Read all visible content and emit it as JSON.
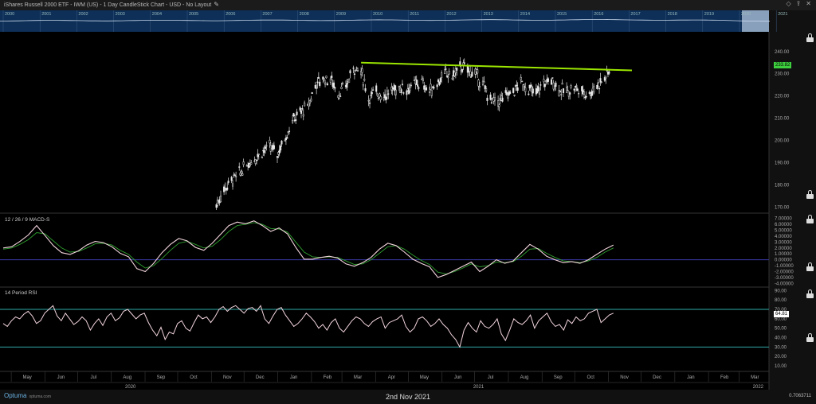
{
  "header": {
    "title": "iShares Russell 2000 ETF - IWM (US) - 1 Day CandleStick Chart - USD - No Layout",
    "icons": [
      "diamond-icon",
      "share-icon",
      "close-icon"
    ]
  },
  "navigator": {
    "years": [
      "2000",
      "2001",
      "2002",
      "2003",
      "2004",
      "2005",
      "2006",
      "2007",
      "2008",
      "2009",
      "2010",
      "2011",
      "2012",
      "2013",
      "2014",
      "2015",
      "2016",
      "2017",
      "2018",
      "2019",
      "2020",
      "2021"
    ]
  },
  "footer": {
    "logo": "Optuma",
    "logo_sub": "optuma.com",
    "date_label": "2nd Nov 2021",
    "scale_value": "0.7063711"
  },
  "colors": {
    "background": "#000000",
    "candle": "#e6e6e6",
    "trendline": "#9be600",
    "macd_line": "#f2d4dc",
    "signal_line": "#2e9e2e",
    "zero_line": "#3a3aa8",
    "rsi_line": "#f2d4dc",
    "rsi_bands": "#2ea8a8",
    "price_tag": "#3ecf3e",
    "rsi_tag": "#ffffff"
  },
  "chart_data": [
    {
      "type": "candlestick",
      "title": "iShares Russell 2000 ETF - IWM (US) - 1 Day CandleStick Chart - USD",
      "x_ticks": [
        "May",
        "Jun",
        "Jul",
        "Aug",
        "Sep",
        "Oct",
        "Nov",
        "Dec",
        "Jan",
        "Feb",
        "Mar",
        "Apr",
        "May",
        "Jun",
        "Jul",
        "Aug",
        "Sep",
        "Oct",
        "Nov",
        "Dec",
        "Jan",
        "Feb",
        "Mar"
      ],
      "x_years": [
        "2020",
        "2021",
        "2022"
      ],
      "ylim": [
        168,
        246
      ],
      "y_ticks": [
        170,
        180,
        190,
        200,
        210,
        220,
        230,
        240
      ],
      "y_tick_labels": [
        "170.00",
        "180.00",
        "190.00",
        "200.00",
        "210.00",
        "220.00",
        "230.00",
        "240.00"
      ],
      "last_price": 233.82,
      "last_price_label": "233.82",
      "close_series": {
        "x": [
          "2020-11-02",
          "2020-11-09",
          "2020-11-16",
          "2020-11-23",
          "2020-11-30",
          "2020-12-07",
          "2020-12-14",
          "2020-12-21",
          "2020-12-28",
          "2021-01-04",
          "2021-01-11",
          "2021-01-19",
          "2021-01-25",
          "2021-02-01",
          "2021-02-08",
          "2021-02-16",
          "2021-02-22",
          "2021-03-01",
          "2021-03-08",
          "2021-03-15",
          "2021-03-22",
          "2021-03-29",
          "2021-04-05",
          "2021-04-12",
          "2021-04-19",
          "2021-04-26",
          "2021-05-03",
          "2021-05-10",
          "2021-05-17",
          "2021-05-24",
          "2021-06-01",
          "2021-06-07",
          "2021-06-14",
          "2021-06-21",
          "2021-06-28",
          "2021-07-06",
          "2021-07-12",
          "2021-07-19",
          "2021-07-26",
          "2021-08-02",
          "2021-08-09",
          "2021-08-16",
          "2021-08-23",
          "2021-08-30",
          "2021-09-07",
          "2021-09-13",
          "2021-09-20",
          "2021-09-27",
          "2021-10-04",
          "2021-10-11",
          "2021-10-18",
          "2021-10-25",
          "2021-11-01"
        ],
        "y": [
          171,
          178,
          182,
          185,
          189,
          192,
          195,
          197,
          194,
          201,
          209,
          213,
          215,
          225,
          228,
          227,
          221,
          224,
          233,
          231,
          219,
          222,
          220,
          222,
          224,
          223,
          225,
          226,
          222,
          226,
          230,
          229,
          233,
          232,
          230,
          224,
          218,
          217,
          220,
          222,
          226,
          223,
          221,
          226,
          227,
          223,
          222,
          224,
          222,
          221,
          225,
          228,
          233.82
        ]
      },
      "trendline": {
        "start": [
          "2021-03-15",
          235
        ],
        "end": [
          "2021-11-19",
          231.5
        ]
      }
    },
    {
      "type": "line",
      "title": "12 / 26 / 9 MACD-S",
      "ylim": [
        -4.5,
        7.5
      ],
      "y_ticks": [
        -4,
        -3,
        -2,
        -1,
        0,
        1,
        2,
        3,
        4,
        5,
        6,
        7
      ],
      "y_tick_labels": [
        "-4.00000",
        "-3.00000",
        "-2.00000",
        "-1.00000",
        "0.00000",
        "1.00000",
        "2.00000",
        "3.00000",
        "4.00000",
        "5.00000",
        "6.00000",
        "7.00000"
      ],
      "series": [
        {
          "values": [
            2,
            2.2,
            3.1,
            4.2,
            5.8,
            4.1,
            2.4,
            1.2,
            0.9,
            1.5,
            2.5,
            3.1,
            2.9,
            2.2,
            1.1,
            0.5,
            -1.5,
            -2.0,
            -0.6,
            1.2,
            2.6,
            3.6,
            3.2,
            2.1,
            1.6,
            2.8,
            4.3,
            5.8,
            6.4,
            6.1,
            6.6,
            5.8,
            4.8,
            5.4,
            4.4,
            2.1,
            0.1,
            0.1,
            0.4,
            0.6,
            0.3,
            -0.7,
            -1.1,
            -0.5,
            0.4,
            1.8,
            2.8,
            2.4,
            1.3,
            0.1,
            -0.6,
            -1.2,
            -3.0,
            -2.5,
            -1.8,
            -1.1,
            -0.4,
            -2.0,
            -1.1,
            0.0,
            -0.6,
            -0.2,
            1.2,
            2.6,
            1.8,
            0.6,
            0.0,
            -0.5,
            -0.3,
            -0.6,
            0.0,
            0.9,
            1.8,
            2.5
          ]
        },
        {
          "values": [
            1.8,
            2.0,
            2.6,
            3.4,
            4.6,
            4.4,
            3.2,
            2.0,
            1.3,
            1.4,
            2.0,
            2.7,
            2.8,
            2.5,
            1.6,
            0.9,
            -0.4,
            -1.4,
            -1.0,
            0.2,
            1.6,
            2.8,
            3.1,
            2.6,
            2.0,
            2.3,
            3.4,
            4.8,
            5.8,
            6.0,
            6.3,
            6.0,
            5.3,
            5.2,
            4.7,
            3.0,
            1.3,
            0.5,
            0.4,
            0.5,
            0.4,
            -0.2,
            -0.8,
            -0.7,
            0.0,
            1.1,
            2.2,
            2.4,
            1.8,
            0.8,
            -0.1,
            -0.8,
            -2.1,
            -2.4,
            -2.0,
            -1.4,
            -0.7,
            -1.2,
            -1.0,
            -0.4,
            -0.5,
            -0.3,
            0.6,
            1.8,
            1.9,
            1.1,
            0.4,
            -0.2,
            -0.3,
            -0.5,
            -0.2,
            0.4,
            1.3,
            2.0
          ]
        }
      ],
      "zero_line": 0
    },
    {
      "type": "line",
      "title": "14 Period RSI",
      "ylim": [
        5,
        92
      ],
      "y_ticks": [
        10,
        20,
        30,
        40,
        50,
        60,
        70,
        80,
        90
      ],
      "y_tick_labels": [
        "10.00",
        "20.00",
        "30.00",
        "40.00",
        "50.00",
        "60.00",
        "70.00",
        "80.00",
        "90.00"
      ],
      "bands": [
        30,
        70
      ],
      "last_value": 64.81,
      "last_value_label": "64.81",
      "series": [
        {
          "values": [
            55,
            52,
            58,
            62,
            60,
            65,
            68,
            63,
            55,
            58,
            66,
            70,
            74,
            63,
            58,
            66,
            60,
            54,
            57,
            62,
            58,
            48,
            55,
            60,
            53,
            62,
            66,
            58,
            61,
            68,
            70,
            65,
            60,
            64,
            66,
            56,
            48,
            42,
            51,
            38,
            46,
            44,
            55,
            58,
            50,
            47,
            56,
            64,
            60,
            62,
            56,
            62,
            70,
            73,
            68,
            72,
            74,
            70,
            66,
            71,
            72,
            68,
            74,
            60,
            55,
            63,
            70,
            72,
            64,
            58,
            52,
            55,
            60,
            66,
            62,
            57,
            50,
            54,
            48,
            56,
            60,
            50,
            46,
            52,
            58,
            62,
            60,
            55,
            52,
            57,
            60,
            62,
            50,
            56,
            58,
            60,
            64,
            52,
            46,
            50,
            60,
            62,
            58,
            52,
            55,
            60,
            54,
            50,
            43,
            38,
            30,
            48,
            56,
            50,
            46,
            58,
            52,
            50,
            54,
            60,
            44,
            37,
            48,
            60,
            56,
            54,
            58,
            64,
            50,
            58,
            62,
            66,
            57,
            52,
            54,
            48,
            59,
            55,
            62,
            58,
            60,
            66,
            68,
            70,
            56,
            60,
            64,
            66
          ]
        }
      ]
    }
  ]
}
